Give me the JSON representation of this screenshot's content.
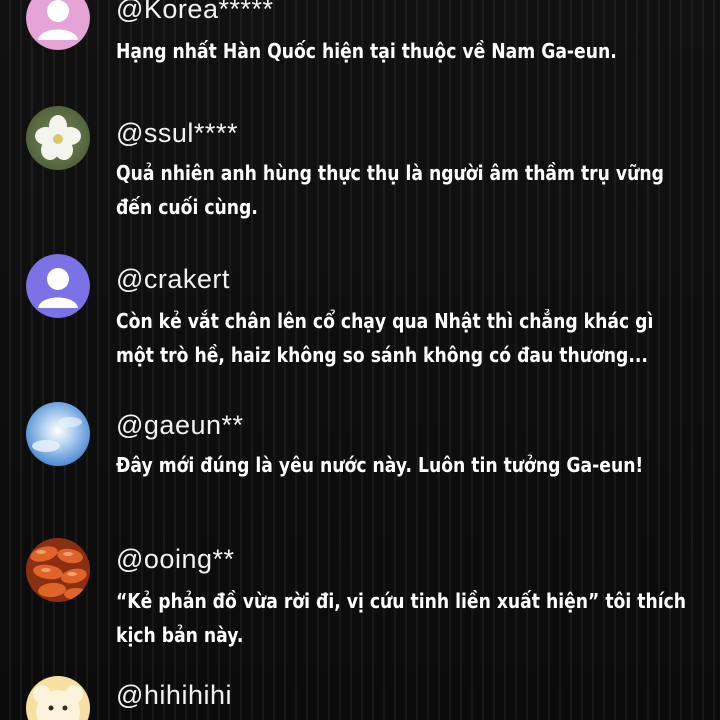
{
  "comments": [
    {
      "username": "@Korea*****",
      "text": [
        "Hạng nhất Hàn Quốc hiện tại thuộc về Nam Ga-eun."
      ],
      "avatar": "default-user-avatar-pink"
    },
    {
      "username": "@ssul****",
      "text": [
        "Quả nhiên anh hùng thực thụ là người âm thầm trụ vững",
        "đến cuối cùng."
      ],
      "avatar": "white-flower-avatar"
    },
    {
      "username": "@crakert",
      "text": [
        "Còn kẻ vắt chân lên cổ chạy qua Nhật thì chẳng khác gì",
        "một trò hề, haiz không so sánh không có đau thương..."
      ],
      "avatar": "default-user-avatar-purple"
    },
    {
      "username": "@gaeun**",
      "text": [
        "Đây mới đúng là yêu nước này. Luôn tin tưởng Ga-eun!"
      ],
      "avatar": "sky-clouds-avatar"
    },
    {
      "username": "@ooing**",
      "text": [
        "“Kẻ phản đồ vừa rời đi, vị cứu tinh liền xuất hiện” tôi thích",
        "kịch bản này."
      ],
      "avatar": "food-avatar"
    },
    {
      "username": "@hihihihi",
      "text": [],
      "avatar": "bear-avatar"
    }
  ]
}
